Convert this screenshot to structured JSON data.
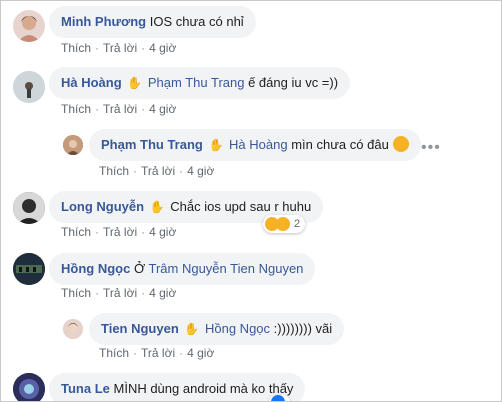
{
  "comments": [
    {
      "author": "Minh Phương",
      "text": "IOS chưa có nhỉ",
      "like": "Thích",
      "reply": "Trả lời",
      "time": "4 giờ"
    },
    {
      "author": "Hà Hoàng",
      "tag": "Phạm Thu Trang",
      "text": "ế đáng iu vc =))",
      "like": "Thích",
      "reply": "Trả lời",
      "time": "4 giờ"
    },
    {
      "author": "Phạm Thu Trang",
      "tag": "Hà Hoàng",
      "text": "mìn chưa có đâu",
      "like": "Thích",
      "reply": "Trả lời",
      "time": "4 giờ"
    },
    {
      "author": "Long Nguyễn",
      "text": "Chắc ios upd sau r huhu",
      "like": "Thích",
      "reply": "Trả lời",
      "time": "4 giờ",
      "reaction_count": "2"
    },
    {
      "author": "Hồng Ngọc",
      "text": "Ở",
      "tag": "Trâm Nguyễn",
      "tag2": "Tien Nguyen",
      "like": "Thích",
      "reply": "Trả lời",
      "time": "4 giờ"
    },
    {
      "author": "Tien Nguyen",
      "tag": "Hồng Ngọc",
      "text": ":)))))))) vãi",
      "like": "Thích",
      "reply": "Trả lời",
      "time": "4 giờ"
    },
    {
      "author": "Tuna Le",
      "text": "MÌNH dùng android mà ko thấy"
    }
  ],
  "icons": {
    "wave": "wave-hand-icon",
    "more": "more-options-icon"
  },
  "colors": {
    "link": "#385898",
    "bubble": "#f2f3f5",
    "meta": "#606770"
  }
}
